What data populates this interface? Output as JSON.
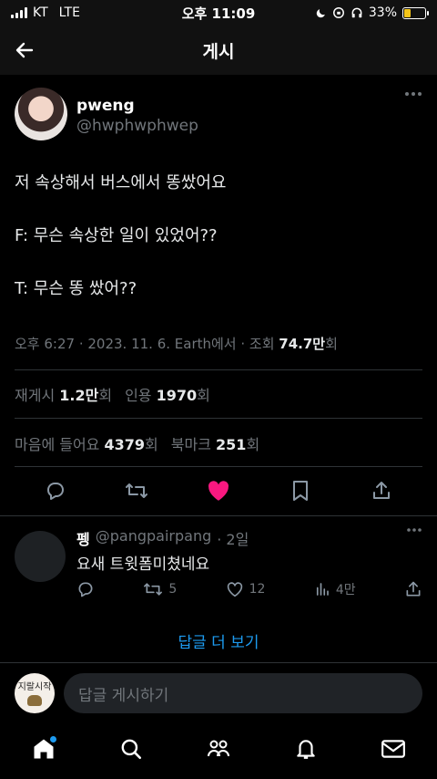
{
  "status_bar": {
    "carrier": "KT",
    "network": "LTE",
    "time": "오후 11:09",
    "battery_percent": "33%",
    "battery_level": 0.33
  },
  "header": {
    "title": "게시"
  },
  "author": {
    "name": "pweng",
    "handle": "@hwphwphwep"
  },
  "tweet": {
    "text": "저 속상해서 버스에서 똥쌌어요\n\nF: 무슨 속상한 일이 있었어??\n\nT: 무슨 똥 쌌어??"
  },
  "meta": {
    "prefix": "오후 6:27 · 2023. 11. 6. Earth에서 · 조회 ",
    "views": "74.7만",
    "views_suffix": "회"
  },
  "stats": {
    "retweets_label": "재게시",
    "retweets": "1.2만",
    "retweets_suffix": "회",
    "quotes_label": "인용",
    "quotes": "1970",
    "quotes_suffix": "회",
    "likes_label": "마음에 들어요",
    "likes": "4379",
    "likes_suffix": "회",
    "bookmarks_label": "북마크",
    "bookmarks": "251",
    "bookmarks_suffix": "회"
  },
  "reply": {
    "name": "펭",
    "handle": "@pangpairpang",
    "time": "· 2일",
    "text": "요새 트윗폼미쳤네요",
    "retweets": "5",
    "likes": "12",
    "views": "4만"
  },
  "more_replies": "답글 더 보기",
  "compose": {
    "avatar_text": "지랄시작",
    "placeholder": "답글 게시하기"
  },
  "colors": {
    "accent": "#1d9bf0",
    "like": "#f91880"
  }
}
